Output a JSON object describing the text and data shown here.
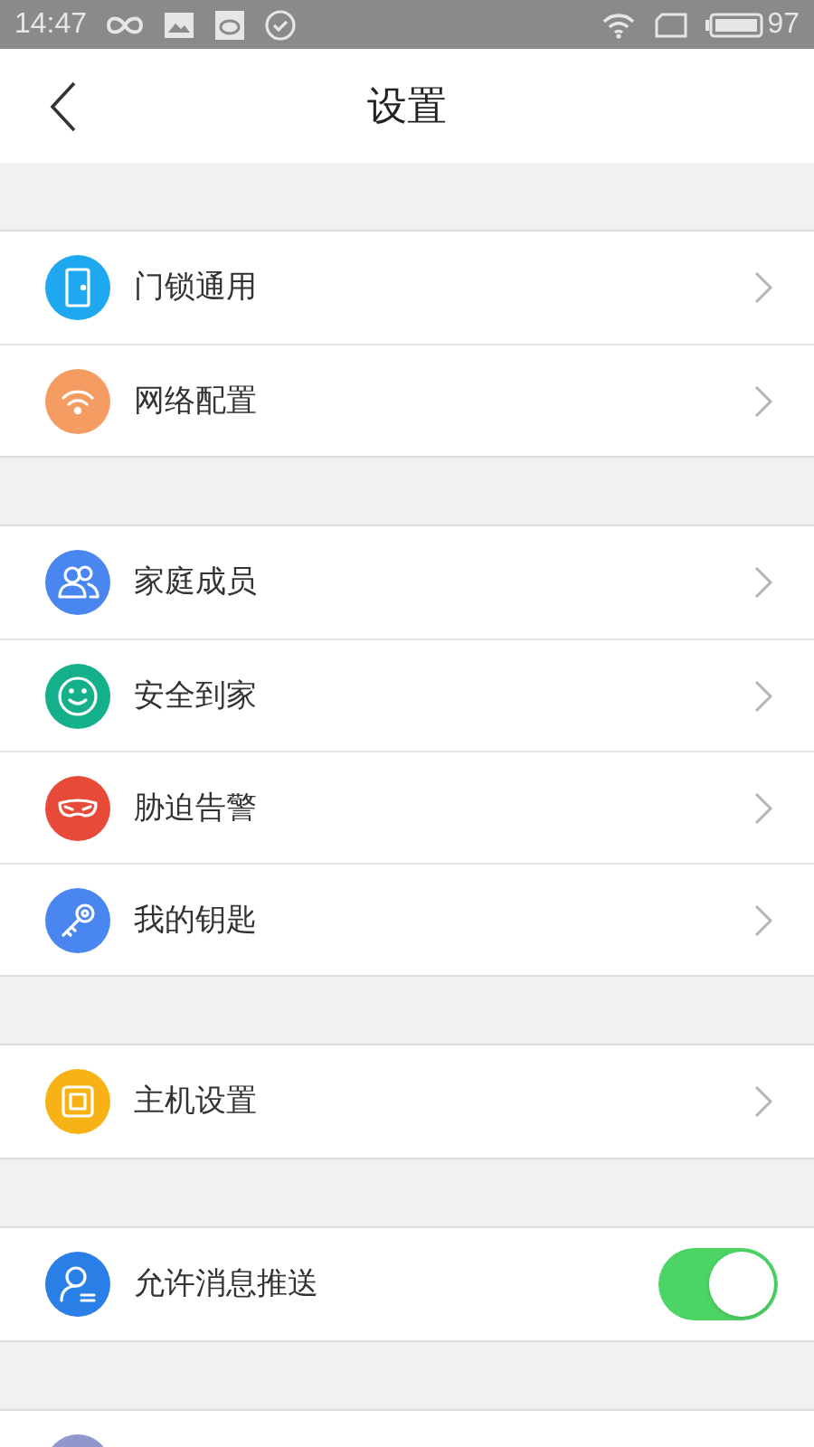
{
  "status_bar": {
    "time": "14:47",
    "battery": "97"
  },
  "header": {
    "title": "设置"
  },
  "groups": [
    {
      "items": [
        {
          "kind": "link",
          "label": "门锁通用",
          "color": "#1ea8f0"
        },
        {
          "kind": "link",
          "label": "网络配置",
          "color": "#f59c62"
        }
      ]
    },
    {
      "items": [
        {
          "kind": "link",
          "label": "家庭成员",
          "color": "#4a86f0"
        },
        {
          "kind": "link",
          "label": "安全到家",
          "color": "#14b08c"
        },
        {
          "kind": "link",
          "label": "胁迫告警",
          "color": "#e84a3a"
        },
        {
          "kind": "link",
          "label": "我的钥匙",
          "color": "#4a86f0"
        }
      ]
    },
    {
      "items": [
        {
          "kind": "link",
          "label": "主机设置",
          "color": "#f7b316"
        }
      ]
    },
    {
      "items": [
        {
          "kind": "toggle",
          "label": "允许消息推送",
          "color": "#2a7fe6",
          "on": true
        }
      ]
    },
    {
      "items": [
        {
          "kind": "stub",
          "color": "#8f97cc"
        }
      ]
    }
  ]
}
